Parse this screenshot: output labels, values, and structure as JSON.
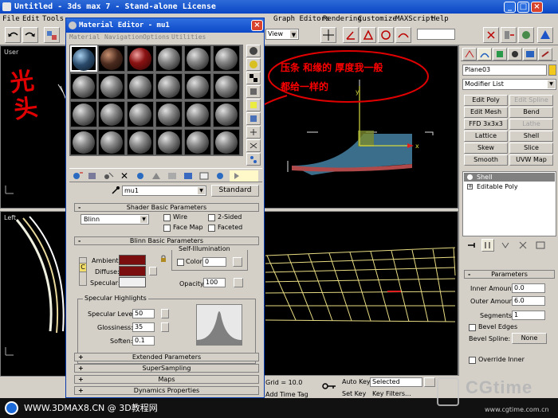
{
  "window": {
    "title": "Untitled - 3ds max 7 - Stand-alone License"
  },
  "menu": [
    "File",
    "Edit",
    "Tools",
    "Graph Editors",
    "Rendering",
    "Customize",
    "MAXScript",
    "Help"
  ],
  "toolbar": {
    "view_dropdown": "View"
  },
  "viewports": {
    "top_left": "User",
    "bottom_left": "Left"
  },
  "annotations": {
    "handwriting_left": "光头",
    "note_line1": "压条  和缘的 厚度我一般",
    "note_line2": "都给一样的"
  },
  "material_editor": {
    "title": "Material Editor - mu1",
    "menu": [
      "Material",
      "Navigation",
      "Options",
      "Utilities"
    ],
    "slot_colors": [
      "#2a4a6a",
      "#4a2a1e",
      "#8a1212"
    ],
    "material_name": "mu1",
    "material_type": "Standard",
    "shader_rollout": "Shader Basic Parameters",
    "shader": "Blinn",
    "shader_options": [
      "Wire",
      "2-Sided",
      "Face Map",
      "Faceted"
    ],
    "blinn_rollout": "Blinn Basic Parameters",
    "self_illum": {
      "title": "Self-Illumination",
      "color_label": "Color",
      "value": "0"
    },
    "color_labels": {
      "ambient": "Ambient:",
      "diffuse": "Diffuse:",
      "specular": "Specular:"
    },
    "ambient_color": "#7a0e0e",
    "diffuse_color": "#7a0e0e",
    "specular_color": "#f0f0f0",
    "lock_letter": "C",
    "opacity": {
      "label": "Opacity:",
      "value": "100"
    },
    "highlights": {
      "title": "Specular Highlights",
      "specular_level_label": "Specular Level:",
      "specular_level": "50",
      "glossiness_label": "Glossiness:",
      "glossiness": "35",
      "soften_label": "Soften:",
      "soften": "0.1"
    },
    "rollouts": [
      "Extended Parameters",
      "SuperSampling",
      "Maps",
      "Dynamics Properties"
    ]
  },
  "command_panel": {
    "object_name": "Plane03",
    "modifier_list": "Modifier List",
    "buttons": [
      [
        "Edit Poly",
        "Edit Spline"
      ],
      [
        "Edit Mesh",
        "Bend"
      ],
      [
        "FFD 3x3x3",
        "Lathe"
      ],
      [
        "Lattice",
        "Shell"
      ],
      [
        "Skew",
        "Slice"
      ],
      [
        "Smooth",
        "UVW Map"
      ]
    ],
    "stack": [
      "Shell",
      "Editable Poly"
    ],
    "parameters": {
      "title": "Parameters",
      "inner_amount_label": "Inner Amount:",
      "inner_amount": "0.0",
      "outer_amount_label": "Outer Amount:",
      "outer_amount": "6.0",
      "segments_label": "Segments:",
      "segments": "1",
      "bevel_edges": "Bevel Edges",
      "bevel_spline_label": "Bevel Spline:",
      "bevel_spline_value": "None",
      "override_inner": "Override Inner"
    }
  },
  "status_bar": {
    "grid": "Grid = 10.0",
    "add_time_tag": "Add Time Tag",
    "auto_key": "Auto Key",
    "set_key": "Set Key",
    "selected": "Selected",
    "key_filters": "Key Filters..."
  },
  "footer": {
    "left_text": "WWW.3DMAX8.CN @ 3D教程网",
    "watermark": "CGtime",
    "watermark_url": "www.cgtime.com.cn"
  }
}
